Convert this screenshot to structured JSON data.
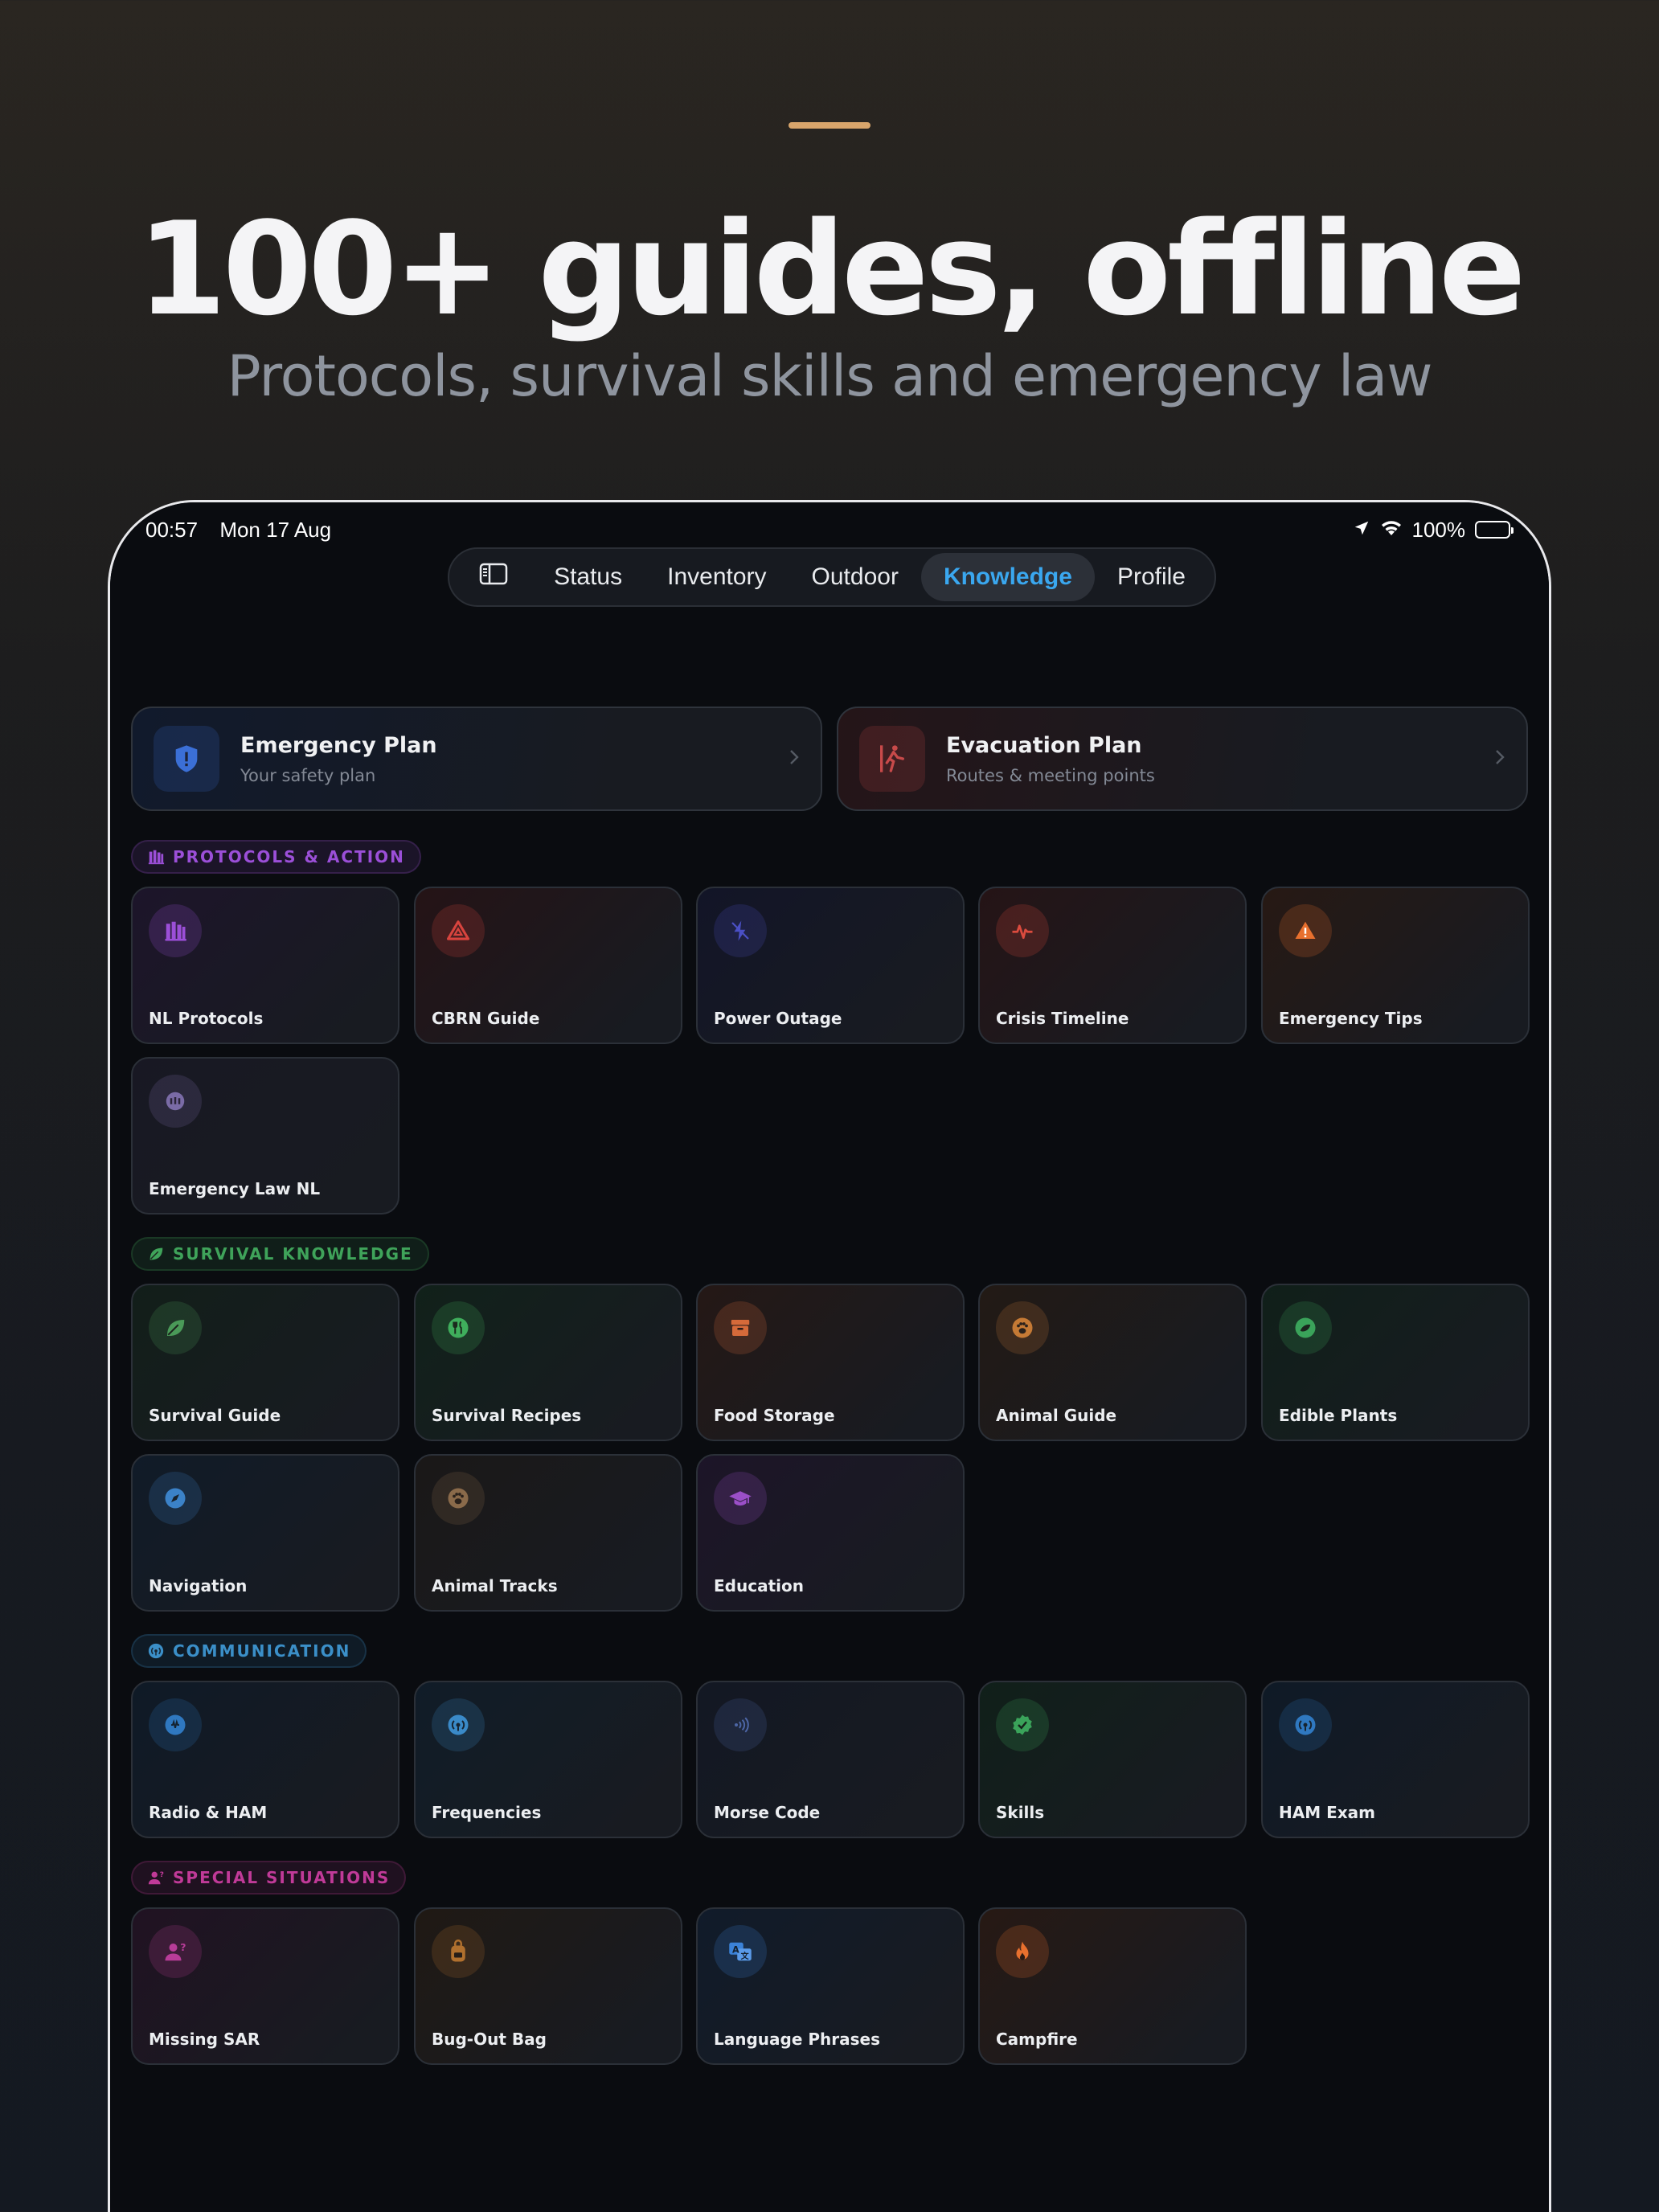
{
  "hero": {
    "headline": "100+ guides, offline",
    "subheadline": "Protocols, survival skills and emergency law"
  },
  "status_bar": {
    "time": "00:57",
    "date": "Mon 17 Aug",
    "battery": "100%"
  },
  "tabs": [
    {
      "label": "Status"
    },
    {
      "label": "Inventory"
    },
    {
      "label": "Outdoor"
    },
    {
      "label": "Knowledge",
      "active": true
    },
    {
      "label": "Profile"
    }
  ],
  "plans": [
    {
      "title": "Emergency Plan",
      "subtitle": "Your safety plan",
      "icon": "shield-alert-icon",
      "color": "#3b6fd6"
    },
    {
      "title": "Evacuation Plan",
      "subtitle": "Routes & meeting points",
      "icon": "exit-walk-icon",
      "color": "#c84a4a"
    }
  ],
  "sections": [
    {
      "title": "PROTOCOLS & ACTION",
      "color": "#9b4fd8",
      "icon": "books-icon",
      "items": [
        {
          "label": "NL Protocols",
          "icon": "books-icon",
          "color": "#9b4fd8"
        },
        {
          "label": "CBRN Guide",
          "icon": "hazard-triangle-icon",
          "color": "#d8443e"
        },
        {
          "label": "Power Outage",
          "icon": "lightning-off-icon",
          "color": "#4a4fc4"
        },
        {
          "label": "Crisis Timeline",
          "icon": "pulse-icon",
          "color": "#dc4b3e"
        },
        {
          "label": "Emergency Tips",
          "icon": "warning-icon",
          "color": "#e8702e"
        },
        {
          "label": "Emergency Law NL",
          "icon": "law-icon",
          "color": "#7a6ba6"
        }
      ]
    },
    {
      "title": "SURVIVAL KNOWLEDGE",
      "color": "#3fa35a",
      "icon": "leaf-icon",
      "items": [
        {
          "label": "Survival Guide",
          "icon": "leaf-icon",
          "color": "#4a9a58"
        },
        {
          "label": "Survival Recipes",
          "icon": "fork-knife-icon",
          "color": "#3fae5c"
        },
        {
          "label": "Food Storage",
          "icon": "archive-box-icon",
          "color": "#d66a3a"
        },
        {
          "label": "Animal Guide",
          "icon": "paw-icon",
          "color": "#c57a35"
        },
        {
          "label": "Edible Plants",
          "icon": "plant-icon",
          "color": "#3aa35a"
        },
        {
          "label": "Navigation",
          "icon": "compass-icon",
          "color": "#3b82c8"
        },
        {
          "label": "Animal Tracks",
          "icon": "paw-icon",
          "color": "#8a6a4a"
        },
        {
          "label": "Education",
          "icon": "graduation-cap-icon",
          "color": "#9b4fc8"
        }
      ]
    },
    {
      "title": "COMMUNICATION",
      "color": "#3b8fc8",
      "icon": "antenna-icon",
      "items": [
        {
          "label": "Radio & HAM",
          "icon": "radio-wave-icon",
          "color": "#2f78c0"
        },
        {
          "label": "Frequencies",
          "icon": "antenna-icon",
          "color": "#3a8ac8"
        },
        {
          "label": "Morse Code",
          "icon": "signal-dots-icon",
          "color": "#4d66a6"
        },
        {
          "label": "Skills",
          "icon": "verified-badge-icon",
          "color": "#3aa35a"
        },
        {
          "label": "HAM Exam",
          "icon": "antenna-icon",
          "color": "#2f78c0"
        }
      ]
    },
    {
      "title": "SPECIAL SITUATIONS",
      "color": "#c03a98",
      "icon": "person-question-icon",
      "items": [
        {
          "label": "Missing SAR",
          "icon": "person-question-icon",
          "color": "#b83c98"
        },
        {
          "label": "Bug-Out Bag",
          "icon": "backpack-icon",
          "color": "#b0702e"
        },
        {
          "label": "Language Phrases",
          "icon": "translate-icon",
          "color": "#3b82d8"
        },
        {
          "label": "Campfire",
          "icon": "flame-icon",
          "color": "#e8702e"
        }
      ]
    }
  ]
}
